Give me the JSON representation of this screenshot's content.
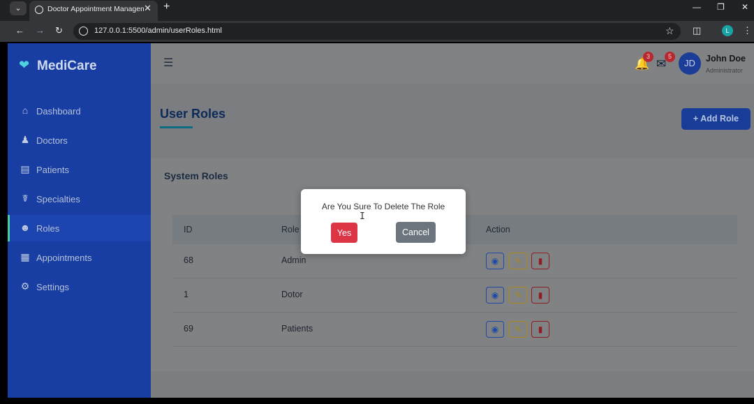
{
  "browser": {
    "tab_title": "Doctor Appointment Managem",
    "url": "127.0.0.1:5500/admin/userRoles.html",
    "profile_initial": "L"
  },
  "app": {
    "brand": "MediCare",
    "sidebar": {
      "items": [
        {
          "label": "Dashboard",
          "icon": "home-icon"
        },
        {
          "label": "Doctors",
          "icon": "doctor-icon"
        },
        {
          "label": "Patients",
          "icon": "bed-icon"
        },
        {
          "label": "Specialties",
          "icon": "stethoscope-icon"
        },
        {
          "label": "Roles",
          "icon": "users-icon",
          "active": true
        },
        {
          "label": "Appointments",
          "icon": "calendar-icon"
        },
        {
          "label": "Settings",
          "icon": "gear-icon"
        }
      ]
    },
    "header": {
      "notifications_count": "3",
      "messages_count": "5",
      "avatar_initials": "JD",
      "user_name": "John Doe",
      "user_role": "Administrator"
    },
    "page": {
      "title": "User Roles",
      "add_button": "+ Add Role",
      "card_title": "System Roles",
      "columns": [
        "ID",
        "Role",
        "Action"
      ],
      "rows": [
        {
          "id": "68",
          "role": "Admin"
        },
        {
          "id": "1",
          "role": "Dotor"
        },
        {
          "id": "69",
          "role": "Patients"
        }
      ]
    },
    "modal": {
      "message": "Are You Sure To Delete The Role",
      "yes_label": "Yes",
      "cancel_label": "Cancel"
    },
    "colors": {
      "sidebar": "#183ea3",
      "accent": "#3fd0a8",
      "danger": "#dc3545",
      "secondary": "#6c757d",
      "primary": "#183c98"
    }
  }
}
